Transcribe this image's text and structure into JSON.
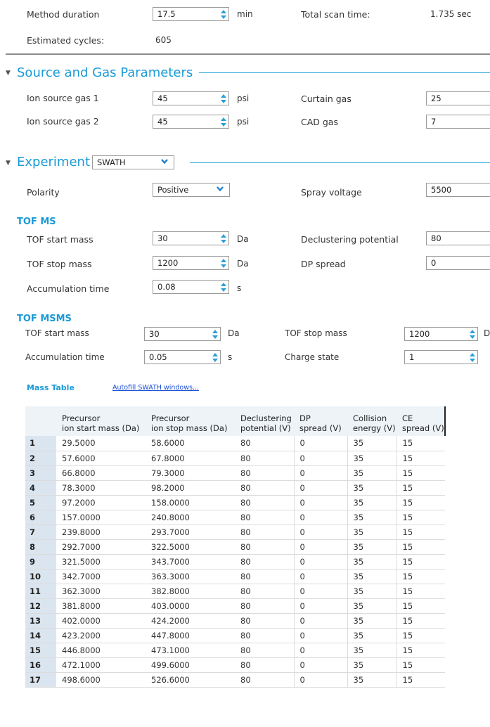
{
  "top": {
    "method_duration_label": "Method duration",
    "method_duration_value": "17.5",
    "method_duration_unit": "min",
    "total_scan_time_label": "Total scan time:",
    "total_scan_time_value": "1.735 sec",
    "estimated_cycles_label": "Estimated cycles:",
    "estimated_cycles_value": "605"
  },
  "source_gas": {
    "title": "Source and Gas Parameters",
    "ion_source_gas1_label": "Ion source gas 1",
    "ion_source_gas1_value": "45",
    "ion_source_gas1_unit": "psi",
    "ion_source_gas2_label": "Ion source gas 2",
    "ion_source_gas2_value": "45",
    "ion_source_gas2_unit": "psi",
    "curtain_gas_label": "Curtain gas",
    "curtain_gas_value": "25",
    "cad_gas_label": "CAD gas",
    "cad_gas_value": "7"
  },
  "experiment": {
    "title": "Experiment",
    "type_selected": "SWATH",
    "polarity_label": "Polarity",
    "polarity_value": "Positive",
    "spray_voltage_label": "Spray voltage",
    "spray_voltage_value": "5500"
  },
  "tof_ms": {
    "title": "TOF MS",
    "start_mass_label": "TOF start mass",
    "start_mass_value": "30",
    "start_mass_unit": "Da",
    "stop_mass_label": "TOF stop mass",
    "stop_mass_value": "1200",
    "stop_mass_unit": "Da",
    "accum_label": "Accumulation time",
    "accum_value": "0.08",
    "accum_unit": "s",
    "dp_label": "Declustering potential",
    "dp_value": "80",
    "dp_spread_label": "DP spread",
    "dp_spread_value": "0"
  },
  "tof_msms": {
    "title": "TOF MSMS",
    "start_mass_label": "TOF start mass",
    "start_mass_value": "30",
    "start_mass_unit": "Da",
    "accum_label": "Accumulation time",
    "accum_value": "0.05",
    "accum_unit": "s",
    "stop_mass_label": "TOF stop mass",
    "stop_mass_value": "1200",
    "stop_mass_unit_partial": "D",
    "charge_state_label": "Charge state",
    "charge_state_value": "1"
  },
  "mass_table": {
    "title": "Mass Table",
    "autofill_link": "Autofill SWATH windows...",
    "headers": [
      [
        "",
        ""
      ],
      [
        "Precursor",
        "ion start mass (Da)"
      ],
      [
        "Precursor",
        "ion stop mass (Da)"
      ],
      [
        "Declustering",
        "potential (V)"
      ],
      [
        "DP",
        "spread (V)"
      ],
      [
        "Collision",
        "energy (V)"
      ],
      [
        "CE",
        "spread (V)"
      ]
    ],
    "rows": [
      [
        "1",
        "29.5000",
        "58.6000",
        "80",
        "0",
        "35",
        "15"
      ],
      [
        "2",
        "57.6000",
        "67.8000",
        "80",
        "0",
        "35",
        "15"
      ],
      [
        "3",
        "66.8000",
        "79.3000",
        "80",
        "0",
        "35",
        "15"
      ],
      [
        "4",
        "78.3000",
        "98.2000",
        "80",
        "0",
        "35",
        "15"
      ],
      [
        "5",
        "97.2000",
        "158.0000",
        "80",
        "0",
        "35",
        "15"
      ],
      [
        "6",
        "157.0000",
        "240.8000",
        "80",
        "0",
        "35",
        "15"
      ],
      [
        "7",
        "239.8000",
        "293.7000",
        "80",
        "0",
        "35",
        "15"
      ],
      [
        "8",
        "292.7000",
        "322.5000",
        "80",
        "0",
        "35",
        "15"
      ],
      [
        "9",
        "321.5000",
        "343.7000",
        "80",
        "0",
        "35",
        "15"
      ],
      [
        "10",
        "342.7000",
        "363.3000",
        "80",
        "0",
        "35",
        "15"
      ],
      [
        "11",
        "362.3000",
        "382.8000",
        "80",
        "0",
        "35",
        "15"
      ],
      [
        "12",
        "381.8000",
        "403.0000",
        "80",
        "0",
        "35",
        "15"
      ],
      [
        "13",
        "402.0000",
        "424.2000",
        "80",
        "0",
        "35",
        "15"
      ],
      [
        "14",
        "423.2000",
        "447.8000",
        "80",
        "0",
        "35",
        "15"
      ],
      [
        "15",
        "446.8000",
        "473.1000",
        "80",
        "0",
        "35",
        "15"
      ],
      [
        "16",
        "472.1000",
        "499.6000",
        "80",
        "0",
        "35",
        "15"
      ],
      [
        "17",
        "498.6000",
        "526.6000",
        "80",
        "0",
        "35",
        "15"
      ]
    ]
  },
  "colors": {
    "accent": "#1a9ad6",
    "rule": "#29a7d9",
    "link": "#1a4fd6",
    "row_header_bg": "#dbe5ef"
  },
  "icons": {
    "spinner": "spin-arrows-icon",
    "dropdown": "chevron-down-icon",
    "collapse": "caret-down-icon"
  }
}
